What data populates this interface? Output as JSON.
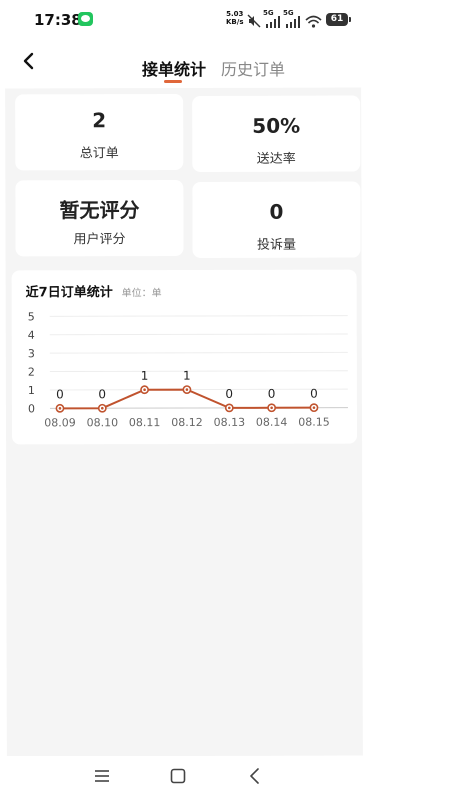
{
  "status_bar": {
    "time": "17:38",
    "net_speed_value": "5.03",
    "net_speed_unit": "KB/s",
    "sim1_label": "5G",
    "sim2_label": "5G",
    "battery": "61",
    "icons": [
      "wechat-icon",
      "mute-icon",
      "signal-icon",
      "wifi-icon",
      "battery-icon"
    ]
  },
  "nav": {
    "tabs": [
      {
        "label": "接单统计",
        "active": true
      },
      {
        "label": "历史订单",
        "active": false
      }
    ],
    "accent_color": "#e0673a"
  },
  "stats": {
    "total_orders": {
      "value": "2",
      "label": "总订单"
    },
    "delivery_rate": {
      "value": "50%",
      "label": "送达率"
    },
    "user_rating": {
      "value": "暂无评分",
      "label": "用户评分"
    },
    "complaints": {
      "value": "0",
      "label": "投诉量"
    }
  },
  "chart": {
    "title": "近7日订单统计",
    "unit": "单位：单"
  },
  "chart_data": {
    "type": "line",
    "categories": [
      "08.09",
      "08.10",
      "08.11",
      "08.12",
      "08.13",
      "08.14",
      "08.15"
    ],
    "values": [
      0,
      0,
      1,
      1,
      0,
      0,
      0
    ],
    "data_labels": [
      "0",
      "0",
      "1",
      "1",
      "0",
      "0",
      "0"
    ],
    "y_ticks": [
      "0",
      "1",
      "2",
      "3",
      "4",
      "5"
    ],
    "ylim": [
      0,
      5
    ],
    "grid": true,
    "line_color": "#c0532e"
  },
  "system_nav": {
    "buttons": [
      "menu-icon",
      "home-icon",
      "back-icon"
    ]
  }
}
